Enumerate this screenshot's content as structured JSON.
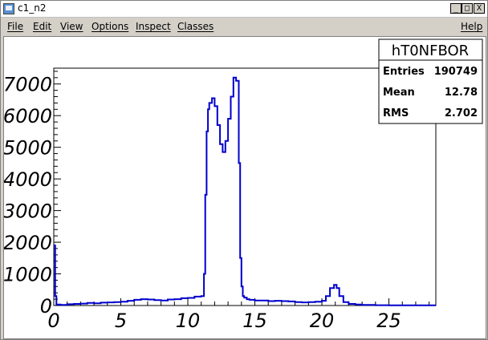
{
  "window": {
    "title": "c1_n2",
    "buttons": {
      "minimize": "_",
      "maximize": "□",
      "close": "X"
    }
  },
  "menubar": {
    "items": [
      "File",
      "Edit",
      "View",
      "Options",
      "Inspect",
      "Classes"
    ],
    "help": "Help"
  },
  "stats_box": {
    "name": "hT0NFBOR",
    "rows": [
      {
        "label": "Entries",
        "value": "190749"
      },
      {
        "label": "Mean",
        "value": "12.78"
      },
      {
        "label": "RMS",
        "value": "2.702"
      }
    ]
  },
  "chart_data": {
    "type": "line",
    "title": "",
    "xlabel": "",
    "ylabel": "",
    "xlim": [
      0,
      28.5
    ],
    "ylim": [
      0,
      7500
    ],
    "x_ticks": [
      0,
      5,
      10,
      15,
      20,
      25
    ],
    "y_ticks": [
      0,
      1000,
      2000,
      3000,
      4000,
      5000,
      6000,
      7000
    ],
    "y_tick_labels": [
      "0",
      "1000",
      "2000",
      "3000",
      "4000",
      "5000",
      "6000",
      "7000"
    ],
    "grid": false,
    "line_color": "#0000cc",
    "series": [
      {
        "x": [
          0.0,
          0.1,
          0.2,
          0.5,
          1.0,
          1.5,
          2.0,
          2.5,
          3.0,
          3.5,
          4.0,
          4.5,
          5.0,
          5.5,
          6.0,
          6.5,
          7.0,
          7.5,
          8.0,
          8.5,
          9.0,
          9.5,
          10.0,
          10.5,
          11.0,
          11.2,
          11.3,
          11.4,
          11.5,
          11.6,
          11.8,
          12.0,
          12.2,
          12.4,
          12.6,
          12.8,
          13.0,
          13.2,
          13.4,
          13.6,
          13.8,
          13.9,
          14.0,
          14.1,
          14.2,
          14.4,
          14.6,
          15.0,
          15.5,
          16.0,
          16.5,
          17.0,
          17.5,
          18.0,
          18.5,
          19.0,
          19.5,
          20.0,
          20.3,
          20.6,
          20.9,
          21.1,
          21.3,
          21.6,
          22.0,
          22.5,
          23.0,
          24.0,
          25.0,
          26.0,
          27.0,
          28.0
        ],
        "y": [
          1900,
          300,
          30,
          20,
          40,
          50,
          60,
          80,
          70,
          90,
          100,
          110,
          120,
          150,
          180,
          200,
          190,
          170,
          160,
          190,
          200,
          230,
          240,
          280,
          300,
          1000,
          3500,
          5500,
          6200,
          6400,
          6550,
          6300,
          5700,
          5100,
          4850,
          5200,
          5900,
          6600,
          7200,
          7100,
          4500,
          1500,
          600,
          300,
          250,
          200,
          180,
          160,
          160,
          140,
          150,
          140,
          130,
          110,
          100,
          110,
          120,
          150,
          300,
          550,
          650,
          550,
          300,
          110,
          50,
          30,
          20,
          10,
          5,
          5,
          5,
          5
        ]
      }
    ]
  }
}
